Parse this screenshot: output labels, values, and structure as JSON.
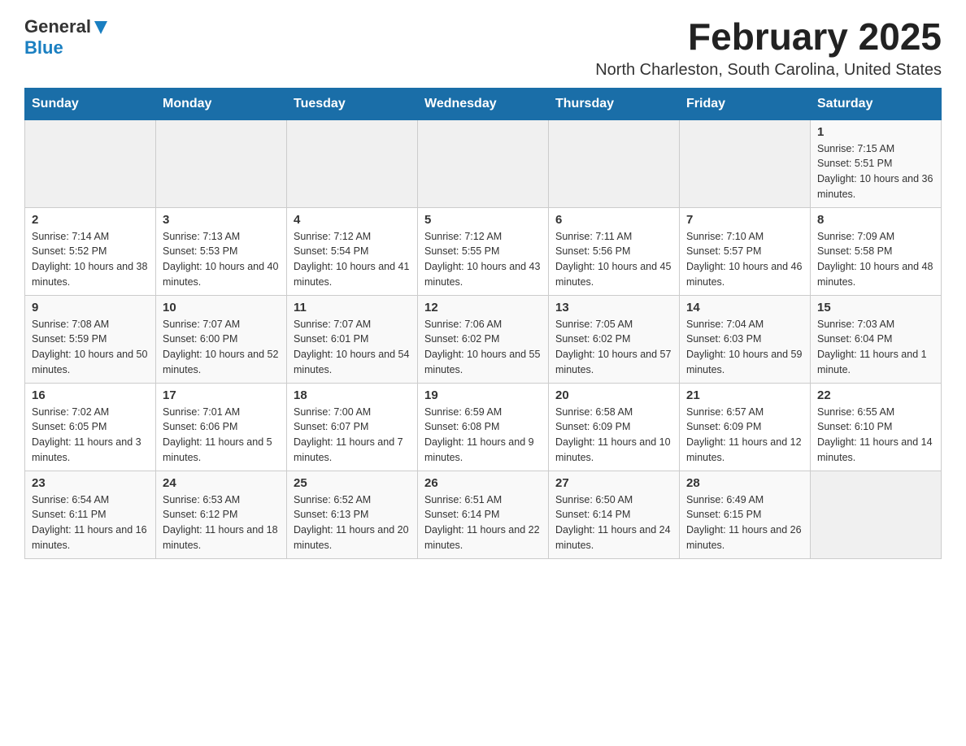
{
  "header": {
    "logo_general": "General",
    "logo_blue": "Blue",
    "month_title": "February 2025",
    "location": "North Charleston, South Carolina, United States"
  },
  "days_of_week": [
    "Sunday",
    "Monday",
    "Tuesday",
    "Wednesday",
    "Thursday",
    "Friday",
    "Saturday"
  ],
  "weeks": [
    [
      {
        "day": "",
        "sunrise": "",
        "sunset": "",
        "daylight": ""
      },
      {
        "day": "",
        "sunrise": "",
        "sunset": "",
        "daylight": ""
      },
      {
        "day": "",
        "sunrise": "",
        "sunset": "",
        "daylight": ""
      },
      {
        "day": "",
        "sunrise": "",
        "sunset": "",
        "daylight": ""
      },
      {
        "day": "",
        "sunrise": "",
        "sunset": "",
        "daylight": ""
      },
      {
        "day": "",
        "sunrise": "",
        "sunset": "",
        "daylight": ""
      },
      {
        "day": "1",
        "sunrise": "Sunrise: 7:15 AM",
        "sunset": "Sunset: 5:51 PM",
        "daylight": "Daylight: 10 hours and 36 minutes."
      }
    ],
    [
      {
        "day": "2",
        "sunrise": "Sunrise: 7:14 AM",
        "sunset": "Sunset: 5:52 PM",
        "daylight": "Daylight: 10 hours and 38 minutes."
      },
      {
        "day": "3",
        "sunrise": "Sunrise: 7:13 AM",
        "sunset": "Sunset: 5:53 PM",
        "daylight": "Daylight: 10 hours and 40 minutes."
      },
      {
        "day": "4",
        "sunrise": "Sunrise: 7:12 AM",
        "sunset": "Sunset: 5:54 PM",
        "daylight": "Daylight: 10 hours and 41 minutes."
      },
      {
        "day": "5",
        "sunrise": "Sunrise: 7:12 AM",
        "sunset": "Sunset: 5:55 PM",
        "daylight": "Daylight: 10 hours and 43 minutes."
      },
      {
        "day": "6",
        "sunrise": "Sunrise: 7:11 AM",
        "sunset": "Sunset: 5:56 PM",
        "daylight": "Daylight: 10 hours and 45 minutes."
      },
      {
        "day": "7",
        "sunrise": "Sunrise: 7:10 AM",
        "sunset": "Sunset: 5:57 PM",
        "daylight": "Daylight: 10 hours and 46 minutes."
      },
      {
        "day": "8",
        "sunrise": "Sunrise: 7:09 AM",
        "sunset": "Sunset: 5:58 PM",
        "daylight": "Daylight: 10 hours and 48 minutes."
      }
    ],
    [
      {
        "day": "9",
        "sunrise": "Sunrise: 7:08 AM",
        "sunset": "Sunset: 5:59 PM",
        "daylight": "Daylight: 10 hours and 50 minutes."
      },
      {
        "day": "10",
        "sunrise": "Sunrise: 7:07 AM",
        "sunset": "Sunset: 6:00 PM",
        "daylight": "Daylight: 10 hours and 52 minutes."
      },
      {
        "day": "11",
        "sunrise": "Sunrise: 7:07 AM",
        "sunset": "Sunset: 6:01 PM",
        "daylight": "Daylight: 10 hours and 54 minutes."
      },
      {
        "day": "12",
        "sunrise": "Sunrise: 7:06 AM",
        "sunset": "Sunset: 6:02 PM",
        "daylight": "Daylight: 10 hours and 55 minutes."
      },
      {
        "day": "13",
        "sunrise": "Sunrise: 7:05 AM",
        "sunset": "Sunset: 6:02 PM",
        "daylight": "Daylight: 10 hours and 57 minutes."
      },
      {
        "day": "14",
        "sunrise": "Sunrise: 7:04 AM",
        "sunset": "Sunset: 6:03 PM",
        "daylight": "Daylight: 10 hours and 59 minutes."
      },
      {
        "day": "15",
        "sunrise": "Sunrise: 7:03 AM",
        "sunset": "Sunset: 6:04 PM",
        "daylight": "Daylight: 11 hours and 1 minute."
      }
    ],
    [
      {
        "day": "16",
        "sunrise": "Sunrise: 7:02 AM",
        "sunset": "Sunset: 6:05 PM",
        "daylight": "Daylight: 11 hours and 3 minutes."
      },
      {
        "day": "17",
        "sunrise": "Sunrise: 7:01 AM",
        "sunset": "Sunset: 6:06 PM",
        "daylight": "Daylight: 11 hours and 5 minutes."
      },
      {
        "day": "18",
        "sunrise": "Sunrise: 7:00 AM",
        "sunset": "Sunset: 6:07 PM",
        "daylight": "Daylight: 11 hours and 7 minutes."
      },
      {
        "day": "19",
        "sunrise": "Sunrise: 6:59 AM",
        "sunset": "Sunset: 6:08 PM",
        "daylight": "Daylight: 11 hours and 9 minutes."
      },
      {
        "day": "20",
        "sunrise": "Sunrise: 6:58 AM",
        "sunset": "Sunset: 6:09 PM",
        "daylight": "Daylight: 11 hours and 10 minutes."
      },
      {
        "day": "21",
        "sunrise": "Sunrise: 6:57 AM",
        "sunset": "Sunset: 6:09 PM",
        "daylight": "Daylight: 11 hours and 12 minutes."
      },
      {
        "day": "22",
        "sunrise": "Sunrise: 6:55 AM",
        "sunset": "Sunset: 6:10 PM",
        "daylight": "Daylight: 11 hours and 14 minutes."
      }
    ],
    [
      {
        "day": "23",
        "sunrise": "Sunrise: 6:54 AM",
        "sunset": "Sunset: 6:11 PM",
        "daylight": "Daylight: 11 hours and 16 minutes."
      },
      {
        "day": "24",
        "sunrise": "Sunrise: 6:53 AM",
        "sunset": "Sunset: 6:12 PM",
        "daylight": "Daylight: 11 hours and 18 minutes."
      },
      {
        "day": "25",
        "sunrise": "Sunrise: 6:52 AM",
        "sunset": "Sunset: 6:13 PM",
        "daylight": "Daylight: 11 hours and 20 minutes."
      },
      {
        "day": "26",
        "sunrise": "Sunrise: 6:51 AM",
        "sunset": "Sunset: 6:14 PM",
        "daylight": "Daylight: 11 hours and 22 minutes."
      },
      {
        "day": "27",
        "sunrise": "Sunrise: 6:50 AM",
        "sunset": "Sunset: 6:14 PM",
        "daylight": "Daylight: 11 hours and 24 minutes."
      },
      {
        "day": "28",
        "sunrise": "Sunrise: 6:49 AM",
        "sunset": "Sunset: 6:15 PM",
        "daylight": "Daylight: 11 hours and 26 minutes."
      },
      {
        "day": "",
        "sunrise": "",
        "sunset": "",
        "daylight": ""
      }
    ]
  ]
}
